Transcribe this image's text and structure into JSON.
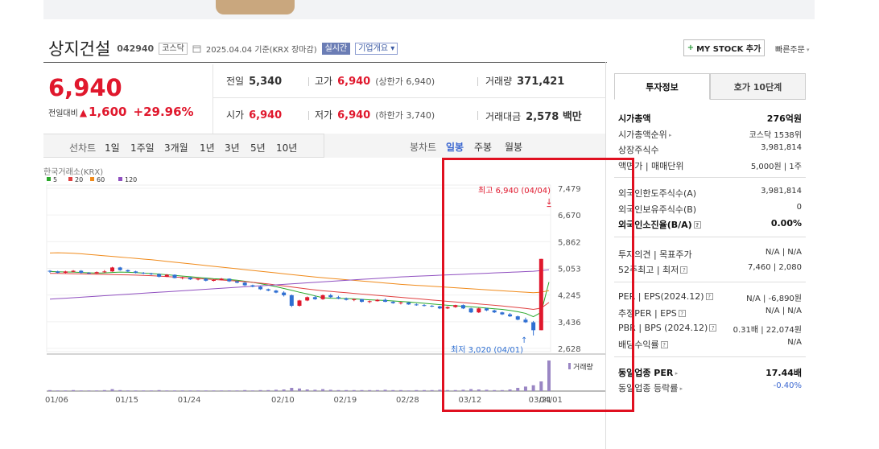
{
  "header": {
    "name": "상지건설",
    "code": "042940",
    "market": "코스닥",
    "date": "2025.04.04 기준(KRX 장마감)",
    "realtime": "실시간",
    "overview": "기업개요",
    "mystock": "MY STOCK 추가",
    "quick": "빠른주문"
  },
  "price": {
    "now": "6,940",
    "change_label": "전일대비",
    "change": "1,600",
    "pct": "+29.96%"
  },
  "summary": {
    "prev_label": "전일",
    "prev": "5,340",
    "high_label": "고가",
    "high": "6,940",
    "upper": "(상한가 6,940)",
    "vol_label": "거래량",
    "vol": "371,421",
    "open_label": "시가",
    "open": "6,940",
    "low_label": "저가",
    "low": "6,940",
    "lower": "(하한가 3,740)",
    "amt_label": "거래대금",
    "amt": "2,578 백만"
  },
  "periods": {
    "left": [
      "선차트",
      "1일",
      "1주일",
      "3개월",
      "1년",
      "3년",
      "5년",
      "10년"
    ],
    "right": [
      "봉차트",
      "일봉",
      "주봉",
      "월봉"
    ],
    "selected": "일봉"
  },
  "chart_data": {
    "type": "candlestick",
    "source": "한국거래소(KRX)",
    "legend": [
      {
        "name": "5",
        "color": "#2aa82a"
      },
      {
        "name": "20",
        "color": "#e04040"
      },
      {
        "name": "60",
        "color": "#f08a1a"
      },
      {
        "name": "120",
        "color": "#9050c0"
      }
    ],
    "yticks": [
      "7,479",
      "6,670",
      "5,862",
      "5,053",
      "4,245",
      "3,436",
      "2,628"
    ],
    "ylim": [
      2628,
      7479
    ],
    "xticks": [
      "01/06",
      "01/15",
      "01/24",
      "02/10",
      "02/19",
      "02/28",
      "03/12",
      "03/21",
      "04/01"
    ],
    "high_label": "최고 6,940 (04/04)",
    "low_label": "최저 3,020 (04/01)",
    "volume_label": "거래량",
    "candles": [
      [
        4980,
        5000,
        4920,
        4960
      ],
      [
        4960,
        4980,
        4900,
        4920
      ],
      [
        4920,
        4980,
        4900,
        4960
      ],
      [
        4950,
        5000,
        4930,
        4980
      ],
      [
        4980,
        5000,
        4900,
        4920
      ],
      [
        4920,
        4940,
        4880,
        4900
      ],
      [
        4900,
        4960,
        4890,
        4940
      ],
      [
        4940,
        5000,
        4920,
        4960
      ],
      [
        4960,
        5100,
        4950,
        5080
      ],
      [
        5080,
        5100,
        4980,
        5000
      ],
      [
        5000,
        5020,
        4940,
        4960
      ],
      [
        4960,
        4980,
        4900,
        4920
      ],
      [
        4920,
        4940,
        4880,
        4900
      ],
      [
        4900,
        4920,
        4850,
        4880
      ],
      [
        4880,
        4900,
        4780,
        4800
      ],
      [
        4800,
        4880,
        4790,
        4860
      ],
      [
        4860,
        4870,
        4750,
        4760
      ],
      [
        4760,
        4800,
        4720,
        4780
      ],
      [
        4780,
        4790,
        4700,
        4720
      ],
      [
        4720,
        4760,
        4690,
        4740
      ],
      [
        4740,
        4760,
        4660,
        4680
      ],
      [
        4680,
        4720,
        4660,
        4700
      ],
      [
        4700,
        4760,
        4690,
        4740
      ],
      [
        4740,
        4750,
        4640,
        4660
      ],
      [
        4660,
        4680,
        4600,
        4620
      ],
      [
        4620,
        4640,
        4520,
        4540
      ],
      [
        4540,
        4560,
        4480,
        4500
      ],
      [
        4500,
        4520,
        4400,
        4420
      ],
      [
        4420,
        4440,
        4360,
        4380
      ],
      [
        4380,
        4400,
        4300,
        4320
      ],
      [
        4320,
        4360,
        4200,
        4240
      ],
      [
        4240,
        4260,
        3880,
        3920
      ],
      [
        3920,
        4100,
        3900,
        4080
      ],
      [
        4080,
        4200,
        4060,
        4180
      ],
      [
        4180,
        4230,
        4100,
        4120
      ],
      [
        4120,
        4260,
        4100,
        4240
      ],
      [
        4240,
        4280,
        4160,
        4180
      ],
      [
        4180,
        4220,
        4120,
        4140
      ],
      [
        4140,
        4170,
        4080,
        4100
      ],
      [
        4100,
        4140,
        4060,
        4120
      ],
      [
        4120,
        4130,
        4020,
        4040
      ],
      [
        4040,
        4080,
        4000,
        4060
      ],
      [
        4060,
        4120,
        4050,
        4100
      ],
      [
        4100,
        4140,
        4030,
        4040
      ],
      [
        4040,
        4060,
        3980,
        4000
      ],
      [
        4000,
        4040,
        3960,
        4020
      ],
      [
        4020,
        4030,
        3950,
        3960
      ],
      [
        3960,
        3990,
        3920,
        3940
      ],
      [
        3940,
        3970,
        3900,
        3920
      ],
      [
        3920,
        3940,
        3880,
        3900
      ],
      [
        3900,
        3920,
        3820,
        3840
      ],
      [
        3840,
        3900,
        3820,
        3880
      ],
      [
        3880,
        3950,
        3860,
        3940
      ],
      [
        3940,
        3960,
        3820,
        3840
      ],
      [
        3840,
        3860,
        3700,
        3720
      ],
      [
        3720,
        3860,
        3700,
        3840
      ],
      [
        3840,
        3860,
        3760,
        3780
      ],
      [
        3780,
        3800,
        3700,
        3720
      ],
      [
        3720,
        3740,
        3640,
        3660
      ],
      [
        3660,
        3700,
        3580,
        3600
      ],
      [
        3600,
        3620,
        3480,
        3500
      ],
      [
        3500,
        3560,
        3400,
        3420
      ],
      [
        3420,
        3460,
        3020,
        3180
      ],
      [
        3180,
        5340,
        3180,
        5340
      ],
      [
        6940,
        6940,
        6940,
        6940
      ]
    ],
    "ma": {
      "5": [
        4960,
        4950,
        4945,
        4940,
        4930,
        4920,
        4910,
        4915,
        4930,
        4940,
        4935,
        4925,
        4910,
        4895,
        4880,
        4860,
        4840,
        4820,
        4800,
        4780,
        4760,
        4740,
        4730,
        4715,
        4695,
        4665,
        4630,
        4590,
        4545,
        4500,
        4445,
        4390,
        4330,
        4280,
        4220,
        4165,
        4150,
        4145,
        4140,
        4130,
        4115,
        4100,
        4090,
        4080,
        4065,
        4050,
        4035,
        4015,
        3995,
        3975,
        3955,
        3935,
        3920,
        3905,
        3890,
        3870,
        3850,
        3830,
        3810,
        3780,
        3740,
        3690,
        3590,
        3720,
        4640
      ],
      "20": [
        4900,
        4900,
        4895,
        4890,
        4885,
        4880,
        4875,
        4870,
        4865,
        4860,
        4855,
        4850,
        4840,
        4830,
        4820,
        4805,
        4790,
        4775,
        4760,
        4745,
        4730,
        4715,
        4700,
        4685,
        4670,
        4650,
        4630,
        4605,
        4580,
        4550,
        4520,
        4490,
        4460,
        4430,
        4400,
        4375,
        4355,
        4335,
        4315,
        4295,
        4275,
        4255,
        4235,
        4215,
        4195,
        4175,
        4155,
        4135,
        4115,
        4095,
        4075,
        4055,
        4035,
        4015,
        3995,
        3975,
        3955,
        3935,
        3915,
        3890,
        3865,
        3840,
        3810,
        3850,
        4020
      ],
      "60": [
        5520,
        5525,
        5520,
        5510,
        5495,
        5475,
        5455,
        5435,
        5415,
        5395,
        5375,
        5355,
        5335,
        5315,
        5290,
        5265,
        5240,
        5215,
        5190,
        5165,
        5140,
        5115,
        5090,
        5065,
        5040,
        5015,
        4990,
        4965,
        4940,
        4915,
        4890,
        4865,
        4840,
        4815,
        4790,
        4770,
        4750,
        4730,
        4710,
        4690,
        4670,
        4650,
        4630,
        4610,
        4590,
        4570,
        4555,
        4540,
        4525,
        4510,
        4495,
        4480,
        4465,
        4450,
        4435,
        4420,
        4405,
        4390,
        4375,
        4360,
        4345,
        4330,
        4315,
        4330,
        4380
      ],
      "120": [
        4120,
        4135,
        4150,
        4165,
        4180,
        4195,
        4210,
        4225,
        4240,
        4255,
        4270,
        4285,
        4300,
        4315,
        4330,
        4345,
        4360,
        4375,
        4390,
        4405,
        4420,
        4435,
        4450,
        4465,
        4480,
        4495,
        4510,
        4525,
        4540,
        4555,
        4570,
        4585,
        4600,
        4615,
        4630,
        4645,
        4660,
        4675,
        4690,
        4705,
        4720,
        4735,
        4750,
        4765,
        4780,
        4795,
        4805,
        4815,
        4825,
        4835,
        4845,
        4855,
        4865,
        4875,
        4885,
        4895,
        4905,
        4915,
        4925,
        4935,
        4945,
        4955,
        4965,
        4985,
        5010
      ]
    },
    "volumes": [
      3,
      2,
      2,
      3,
      2,
      2,
      2,
      3,
      6,
      3,
      2,
      2,
      2,
      2,
      3,
      2,
      2,
      2,
      2,
      2,
      2,
      2,
      2,
      2,
      2,
      3,
      2,
      3,
      3,
      4,
      5,
      10,
      8,
      5,
      4,
      6,
      4,
      3,
      3,
      3,
      3,
      3,
      3,
      4,
      3,
      3,
      2,
      3,
      3,
      3,
      4,
      3,
      3,
      4,
      6,
      5,
      4,
      3,
      3,
      5,
      10,
      14,
      18,
      30,
      95
    ]
  },
  "right": {
    "tabs": [
      "투자정보",
      "호가 10단계"
    ],
    "s1": [
      {
        "k": "시가총액",
        "v": "276억원",
        "kb": true,
        "vb": true
      },
      {
        "k": "시가총액순위",
        "v": "코스닥 1538위",
        "tri": true
      },
      {
        "k": "상장주식수",
        "v": "3,981,814"
      },
      {
        "k": "액면가 | 매매단위",
        "v": "5,000원 | 1주"
      }
    ],
    "s2": [
      {
        "k": "외국인한도주식수(A)",
        "v": "3,981,814"
      },
      {
        "k": "외국인보유주식수(B)",
        "v": "0"
      },
      {
        "k": "외국인소진율(B/A)",
        "v": "0.00%",
        "kb": true,
        "vb": true,
        "q": true
      }
    ],
    "s3": [
      {
        "k": "투자의견 | 목표주가",
        "v": "N/A | N/A"
      },
      {
        "k": "52주최고 | 최저",
        "v": "7,460 | 2,080",
        "q": true
      }
    ],
    "s4": [
      {
        "k": "PER | EPS(2024.12)",
        "v": "N/A | -6,890원",
        "q": true
      },
      {
        "k": "추정PER | EPS",
        "v": "N/A | N/A",
        "q": true
      },
      {
        "k": "PBR | BPS (2024.12)",
        "v": "0.31배 | 22,074원",
        "q": true
      },
      {
        "k": "배당수익률",
        "v": "N/A",
        "q": true
      }
    ],
    "s5": [
      {
        "k": "동일업종 PER",
        "v": "17.44배",
        "kb": true,
        "vb": true,
        "tri": true
      },
      {
        "k": "동일업종 등락률",
        "v": "-0.40%",
        "blue": true,
        "tri": true
      }
    ]
  }
}
